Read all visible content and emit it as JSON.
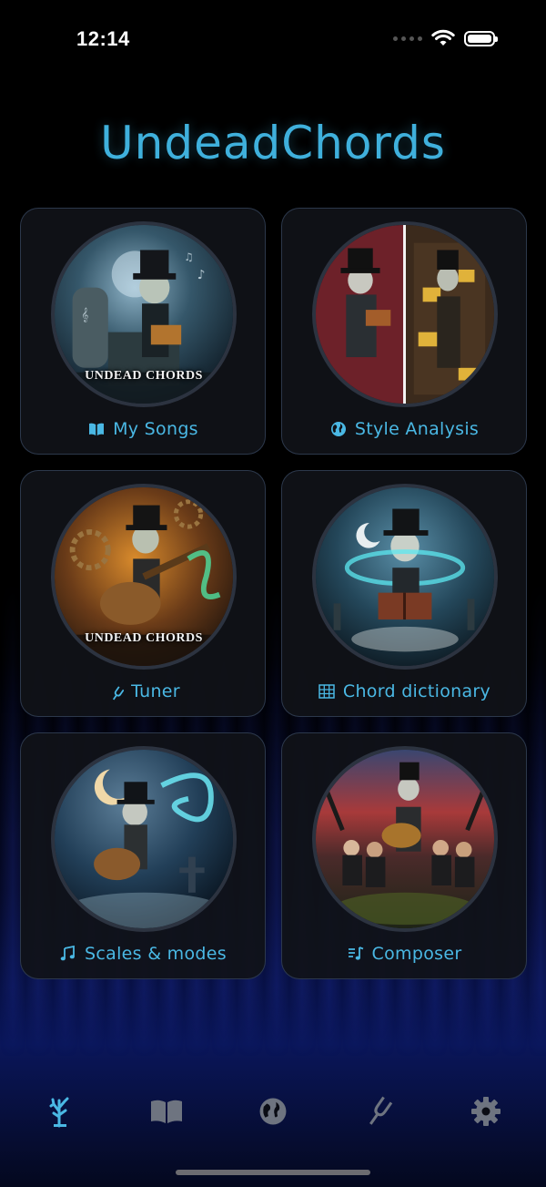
{
  "status_bar": {
    "time": "12:14"
  },
  "app": {
    "title": "UndeadChords"
  },
  "cards": [
    {
      "label": "My Songs",
      "icon": "book-open-icon",
      "brand_text": "UNDEAD CHORDS"
    },
    {
      "label": "Style Analysis",
      "icon": "globe-icon"
    },
    {
      "label": "Tuner",
      "icon": "tuning-fork-icon",
      "brand_text": "UNDEAD CHORDS"
    },
    {
      "label": "Chord dictionary",
      "icon": "table-grid-icon"
    },
    {
      "label": "Scales & modes",
      "icon": "music-notes-icon"
    },
    {
      "label": "Composer",
      "icon": "music-list-icon"
    }
  ],
  "tab_bar": {
    "items": [
      {
        "icon": "tree-icon",
        "selected": true
      },
      {
        "icon": "book-icon",
        "selected": false
      },
      {
        "icon": "globe-icon",
        "selected": false
      },
      {
        "icon": "tuning-fork-icon",
        "selected": false
      },
      {
        "icon": "gear-icon",
        "selected": false
      }
    ]
  },
  "colors": {
    "accent": "#4ab8e4",
    "tab_inactive": "#6e7480",
    "card_background": "#101218"
  }
}
